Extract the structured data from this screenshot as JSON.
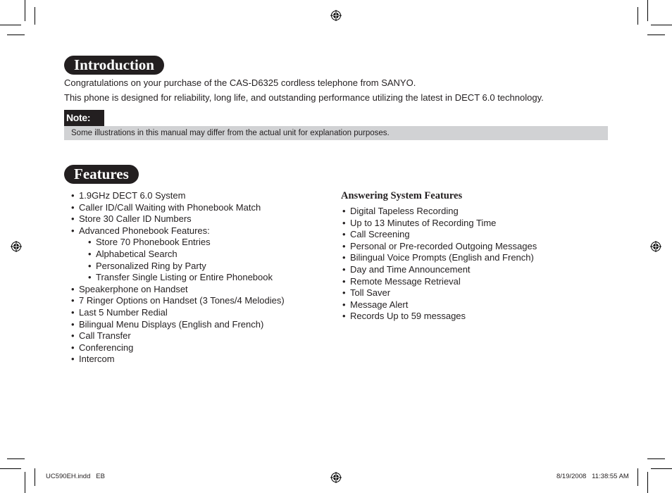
{
  "introduction": {
    "heading": "Introduction",
    "paragraphs": [
      "Congratulations on your purchase of the CAS-D6325 cordless telephone from SANYO.",
      "This phone is designed for reliability, long life, and outstanding performance utilizing the latest in DECT 6.0 technology."
    ],
    "note_label": "Note:",
    "note_text": "Some illustrations in this manual may differ from the actual unit for explanation purposes."
  },
  "features": {
    "heading": "Features",
    "bullet": "•",
    "items": [
      {
        "text": "1.9GHz DECT 6.0 System",
        "level": 1
      },
      {
        "text": "Caller ID/Call Waiting with Phonebook Match",
        "level": 1
      },
      {
        "text": "Store 30 Caller ID Numbers",
        "level": 1
      },
      {
        "text": "Advanced Phonebook Features:",
        "level": 1
      },
      {
        "text": "Store 70 Phonebook Entries",
        "level": 2
      },
      {
        "text": "Alphabetical Search",
        "level": 2
      },
      {
        "text": "Personalized Ring by Party",
        "level": 2
      },
      {
        "text": "Transfer Single Listing or Entire Phonebook",
        "level": 2
      },
      {
        "text": "Speakerphone on Handset",
        "level": 1
      },
      {
        "text": "7 Ringer Options on Handset (3 Tones/4 Melodies)",
        "level": 1
      },
      {
        "text": "Last 5 Number Redial",
        "level": 1
      },
      {
        "text": "Bilingual Menu Displays (English and French)",
        "level": 1
      },
      {
        "text": "Call Transfer",
        "level": 1
      },
      {
        "text": "Conferencing",
        "level": 1
      },
      {
        "text": "Intercom",
        "level": 1
      }
    ],
    "answering_heading": "Answering System Features",
    "answering_items": [
      "Digital Tapeless Recording",
      "Up to 13 Minutes of Recording Time",
      "Call Screening",
      "Personal or Pre-recorded Outgoing Messages",
      "Bilingual Voice Prompts (English and French)",
      "Day and Time Announcement",
      "Remote Message Retrieval",
      "Toll Saver",
      "Message Alert",
      "Records Up to 59 messages"
    ]
  },
  "slug": {
    "file": "UC590EH.indd   EB",
    "timestamp": "8/19/2008   11:38:55 AM"
  },
  "marks": {
    "registration_icon": "registration-target-icon",
    "crop_icon": "crop-mark"
  }
}
